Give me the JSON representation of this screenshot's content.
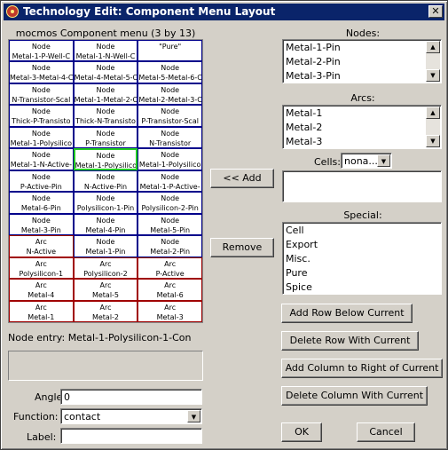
{
  "window": {
    "title": "Technology Edit: Component Menu Layout",
    "close": "✕"
  },
  "grid": {
    "title": "mocmos Component menu (3 by 13)",
    "cells": [
      {
        "type": "node",
        "kind": "Node",
        "name": "Metal-1-P-Well-C"
      },
      {
        "type": "node",
        "kind": "Node",
        "name": "Metal-1-N-Well-C"
      },
      {
        "type": "plain",
        "kind": "\"Pure\"",
        "name": ""
      },
      {
        "type": "node",
        "kind": "Node",
        "name": "Metal-3-Metal-4-C"
      },
      {
        "type": "node",
        "kind": "Node",
        "name": "Metal-4-Metal-5-C"
      },
      {
        "type": "node",
        "kind": "Node",
        "name": "Metal-5-Metal-6-C"
      },
      {
        "type": "node",
        "kind": "Node",
        "name": "N-Transistor-Scal"
      },
      {
        "type": "node",
        "kind": "Node",
        "name": "Metal-1-Metal-2-C"
      },
      {
        "type": "node",
        "kind": "Node",
        "name": "Metal-2-Metal-3-C"
      },
      {
        "type": "node",
        "kind": "Node",
        "name": "Thick-P-Transisto"
      },
      {
        "type": "node",
        "kind": "Node",
        "name": "Thick-N-Transisto"
      },
      {
        "type": "node",
        "kind": "Node",
        "name": "P-Transistor-Scal"
      },
      {
        "type": "node",
        "kind": "Node",
        "name": "Metal-1-Polysilico"
      },
      {
        "type": "node",
        "kind": "Node",
        "name": "P-Transistor"
      },
      {
        "type": "node",
        "kind": "Node",
        "name": "N-Transistor"
      },
      {
        "type": "node",
        "kind": "Node",
        "name": "Metal-1-N-Active-"
      },
      {
        "type": "node",
        "kind": "Node",
        "name": "Metal-1-Polysilico",
        "selected": true
      },
      {
        "type": "node",
        "kind": "Node",
        "name": "Metal-1-Polysilico"
      },
      {
        "type": "node",
        "kind": "Node",
        "name": "P-Active-Pin"
      },
      {
        "type": "node",
        "kind": "Node",
        "name": "N-Active-Pin"
      },
      {
        "type": "node",
        "kind": "Node",
        "name": "Metal-1-P-Active-"
      },
      {
        "type": "node",
        "kind": "Node",
        "name": "Metal-6-Pin"
      },
      {
        "type": "node",
        "kind": "Node",
        "name": "Polysilicon-1-Pin"
      },
      {
        "type": "node",
        "kind": "Node",
        "name": "Polysilicon-2-Pin"
      },
      {
        "type": "node",
        "kind": "Node",
        "name": "Metal-3-Pin"
      },
      {
        "type": "node",
        "kind": "Node",
        "name": "Metal-4-Pin"
      },
      {
        "type": "node",
        "kind": "Node",
        "name": "Metal-5-Pin"
      },
      {
        "type": "arc",
        "kind": "Arc",
        "name": "N-Active"
      },
      {
        "type": "node",
        "kind": "Node",
        "name": "Metal-1-Pin"
      },
      {
        "type": "node",
        "kind": "Node",
        "name": "Metal-2-Pin"
      },
      {
        "type": "arc",
        "kind": "Arc",
        "name": "Polysilicon-1"
      },
      {
        "type": "arc",
        "kind": "Arc",
        "name": "Polysilicon-2"
      },
      {
        "type": "arc",
        "kind": "Arc",
        "name": "P-Active"
      },
      {
        "type": "arc",
        "kind": "Arc",
        "name": "Metal-4"
      },
      {
        "type": "arc",
        "kind": "Arc",
        "name": "Metal-5"
      },
      {
        "type": "arc",
        "kind": "Arc",
        "name": "Metal-6"
      },
      {
        "type": "arc",
        "kind": "Arc",
        "name": "Metal-1"
      },
      {
        "type": "arc",
        "kind": "Arc",
        "name": "Metal-2"
      },
      {
        "type": "arc",
        "kind": "Arc",
        "name": "Metal-3"
      }
    ]
  },
  "node_entry": {
    "label": "Node entry: Metal-1-Polysilicon-1-Con"
  },
  "form": {
    "angle_label": "Angle:",
    "angle_value": "0",
    "function_label": "Function:",
    "function_value": "contact",
    "label_label": "Label:",
    "label_value": ""
  },
  "nodes": {
    "label": "Nodes:",
    "items": [
      "Metal-1-Pin",
      "Metal-2-Pin",
      "Metal-3-Pin"
    ]
  },
  "arcs": {
    "label": "Arcs:",
    "items": [
      "Metal-1",
      "Metal-2",
      "Metal-3"
    ]
  },
  "cells": {
    "label": "Cells:",
    "value": "nona..."
  },
  "special": {
    "label": "Special:",
    "items": [
      "Cell",
      "Export",
      "Misc.",
      "Pure",
      "Spice"
    ]
  },
  "buttons": {
    "add": "<< Add",
    "remove": "Remove",
    "add_row": "Add Row Below Current",
    "delete_row": "Delete Row With Current",
    "add_column": "Add Column to Right of Current",
    "delete_column": "Delete Column With Current",
    "ok": "OK",
    "cancel": "Cancel"
  },
  "icons": {
    "scroll_up": "▲",
    "scroll_down": "▼",
    "dropdown": "▼"
  }
}
